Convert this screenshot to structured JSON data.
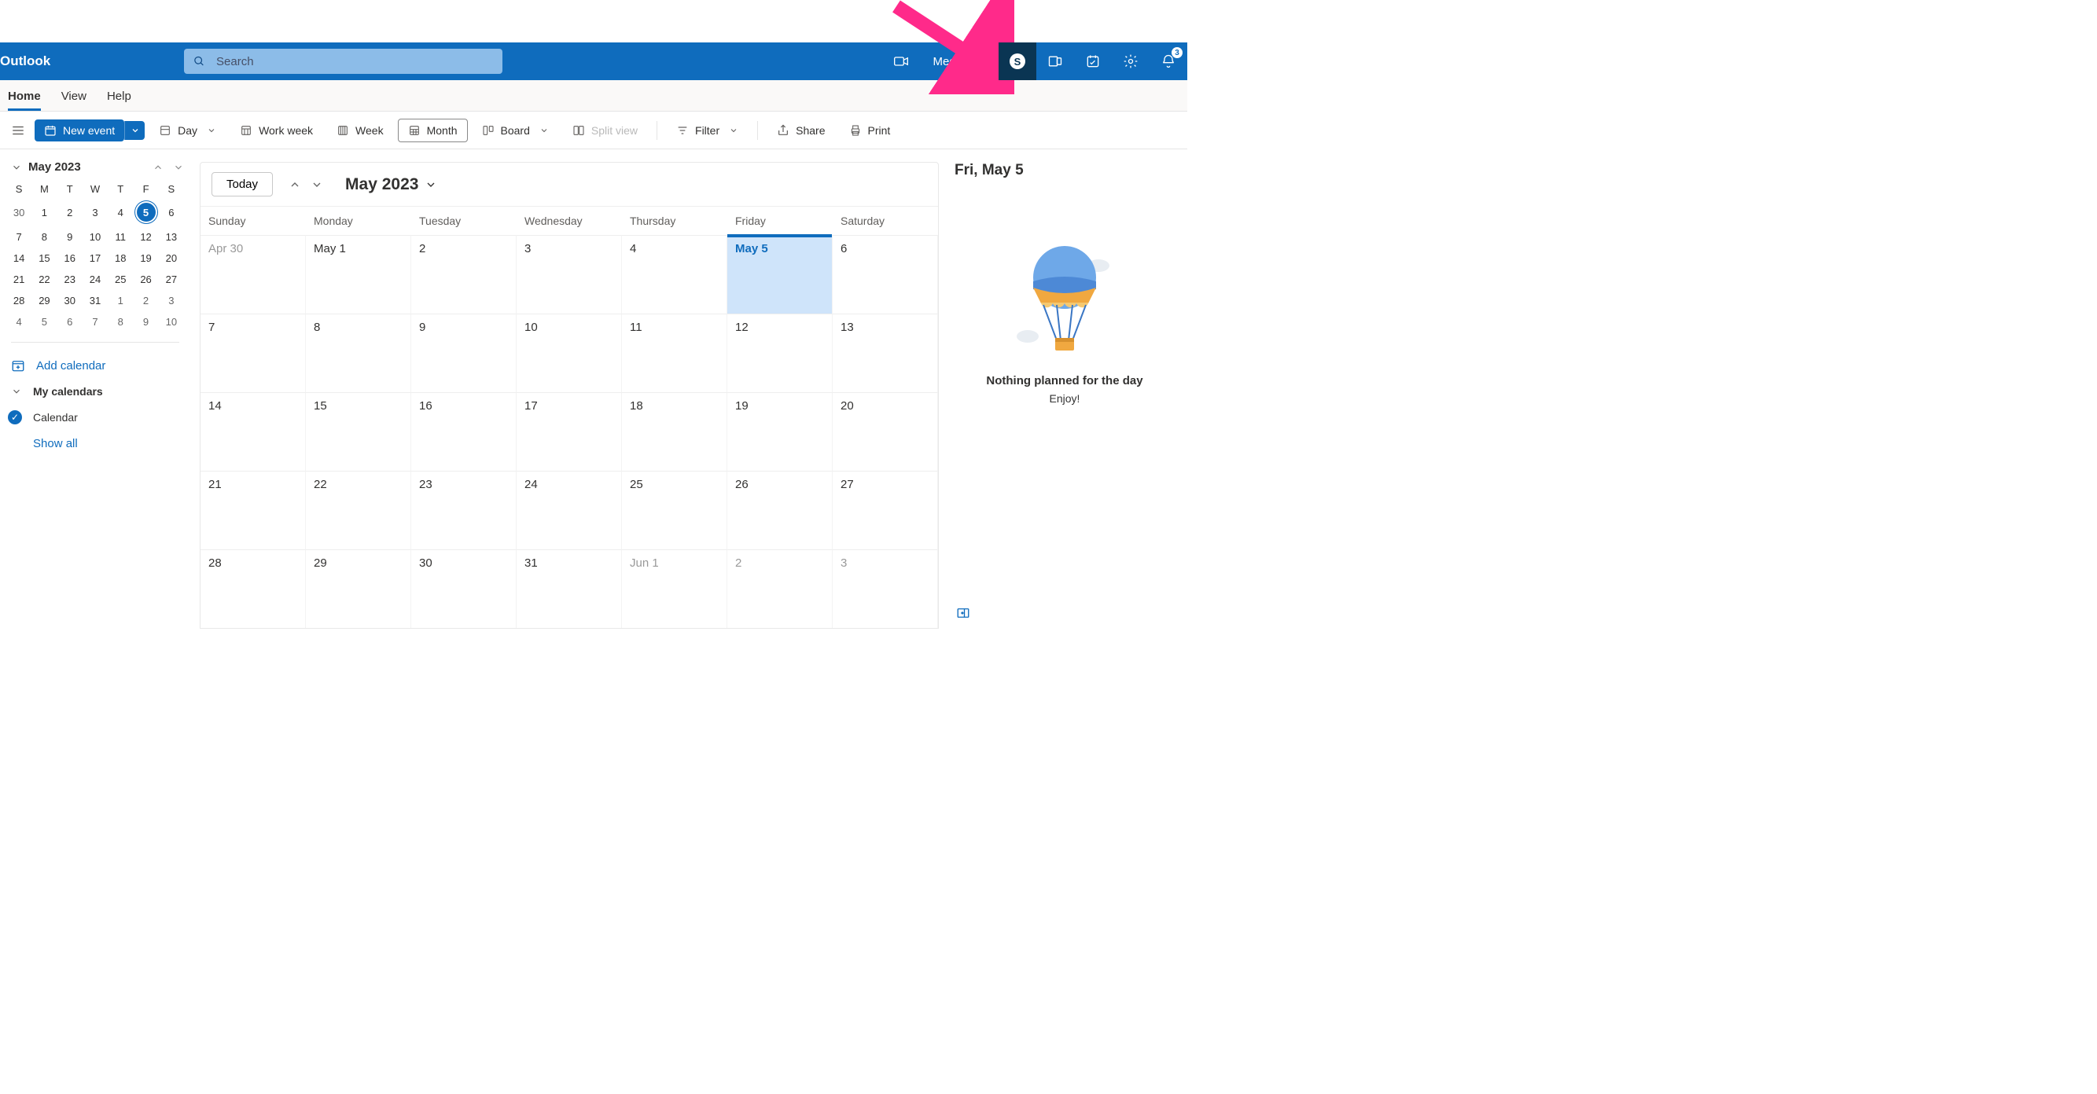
{
  "header": {
    "brand": "Outlook",
    "search_placeholder": "Search",
    "meet_now": "Meet Now",
    "notification_count": "3"
  },
  "nav": {
    "tabs": [
      "Home",
      "View",
      "Help"
    ],
    "active": 0
  },
  "toolbar": {
    "new_event": "New event",
    "day": "Day",
    "work_week": "Work week",
    "week": "Week",
    "month": "Month",
    "board": "Board",
    "split_view": "Split view",
    "filter": "Filter",
    "share": "Share",
    "print": "Print"
  },
  "sidebar": {
    "mini_cal": {
      "title": "May 2023",
      "dow": [
        "S",
        "M",
        "T",
        "W",
        "T",
        "F",
        "S"
      ],
      "weeks": [
        [
          {
            "n": "30"
          },
          {
            "n": "1",
            "in": 1
          },
          {
            "n": "2",
            "in": 1
          },
          {
            "n": "3",
            "in": 1
          },
          {
            "n": "4",
            "in": 1
          },
          {
            "n": "5",
            "in": 1,
            "today": 1
          },
          {
            "n": "6",
            "in": 1
          }
        ],
        [
          {
            "n": "7",
            "in": 1
          },
          {
            "n": "8",
            "in": 1
          },
          {
            "n": "9",
            "in": 1
          },
          {
            "n": "10",
            "in": 1
          },
          {
            "n": "11",
            "in": 1
          },
          {
            "n": "12",
            "in": 1
          },
          {
            "n": "13",
            "in": 1
          }
        ],
        [
          {
            "n": "14",
            "in": 1
          },
          {
            "n": "15",
            "in": 1
          },
          {
            "n": "16",
            "in": 1
          },
          {
            "n": "17",
            "in": 1
          },
          {
            "n": "18",
            "in": 1
          },
          {
            "n": "19",
            "in": 1
          },
          {
            "n": "20",
            "in": 1
          }
        ],
        [
          {
            "n": "21",
            "in": 1
          },
          {
            "n": "22",
            "in": 1
          },
          {
            "n": "23",
            "in": 1
          },
          {
            "n": "24",
            "in": 1
          },
          {
            "n": "25",
            "in": 1
          },
          {
            "n": "26",
            "in": 1
          },
          {
            "n": "27",
            "in": 1
          }
        ],
        [
          {
            "n": "28",
            "in": 1
          },
          {
            "n": "29",
            "in": 1
          },
          {
            "n": "30",
            "in": 1
          },
          {
            "n": "31",
            "in": 1
          },
          {
            "n": "1"
          },
          {
            "n": "2"
          },
          {
            "n": "3"
          }
        ],
        [
          {
            "n": "4"
          },
          {
            "n": "5"
          },
          {
            "n": "6"
          },
          {
            "n": "7"
          },
          {
            "n": "8"
          },
          {
            "n": "9"
          },
          {
            "n": "10"
          }
        ]
      ]
    },
    "add_calendar": "Add calendar",
    "my_calendars": "My calendars",
    "calendar_item": "Calendar",
    "show_all": "Show all"
  },
  "main_cal": {
    "today_btn": "Today",
    "title": "May 2023",
    "dow": [
      "Sunday",
      "Monday",
      "Tuesday",
      "Wednesday",
      "Thursday",
      "Friday",
      "Saturday"
    ],
    "weeks": [
      [
        {
          "t": "Apr 30",
          "o": 1
        },
        {
          "t": "May 1"
        },
        {
          "t": "2"
        },
        {
          "t": "3"
        },
        {
          "t": "4"
        },
        {
          "t": "May 5",
          "today": 1
        },
        {
          "t": "6"
        }
      ],
      [
        {
          "t": "7"
        },
        {
          "t": "8"
        },
        {
          "t": "9"
        },
        {
          "t": "10"
        },
        {
          "t": "11"
        },
        {
          "t": "12"
        },
        {
          "t": "13"
        }
      ],
      [
        {
          "t": "14"
        },
        {
          "t": "15"
        },
        {
          "t": "16"
        },
        {
          "t": "17"
        },
        {
          "t": "18"
        },
        {
          "t": "19"
        },
        {
          "t": "20"
        }
      ],
      [
        {
          "t": "21"
        },
        {
          "t": "22"
        },
        {
          "t": "23"
        },
        {
          "t": "24"
        },
        {
          "t": "25"
        },
        {
          "t": "26"
        },
        {
          "t": "27"
        }
      ],
      [
        {
          "t": "28"
        },
        {
          "t": "29"
        },
        {
          "t": "30"
        },
        {
          "t": "31"
        },
        {
          "t": "Jun 1",
          "o": 1
        },
        {
          "t": "2",
          "o": 1
        },
        {
          "t": "3",
          "o": 1
        }
      ]
    ]
  },
  "agenda": {
    "title": "Fri, May 5",
    "empty_title": "Nothing planned for the day",
    "empty_sub": "Enjoy!"
  }
}
